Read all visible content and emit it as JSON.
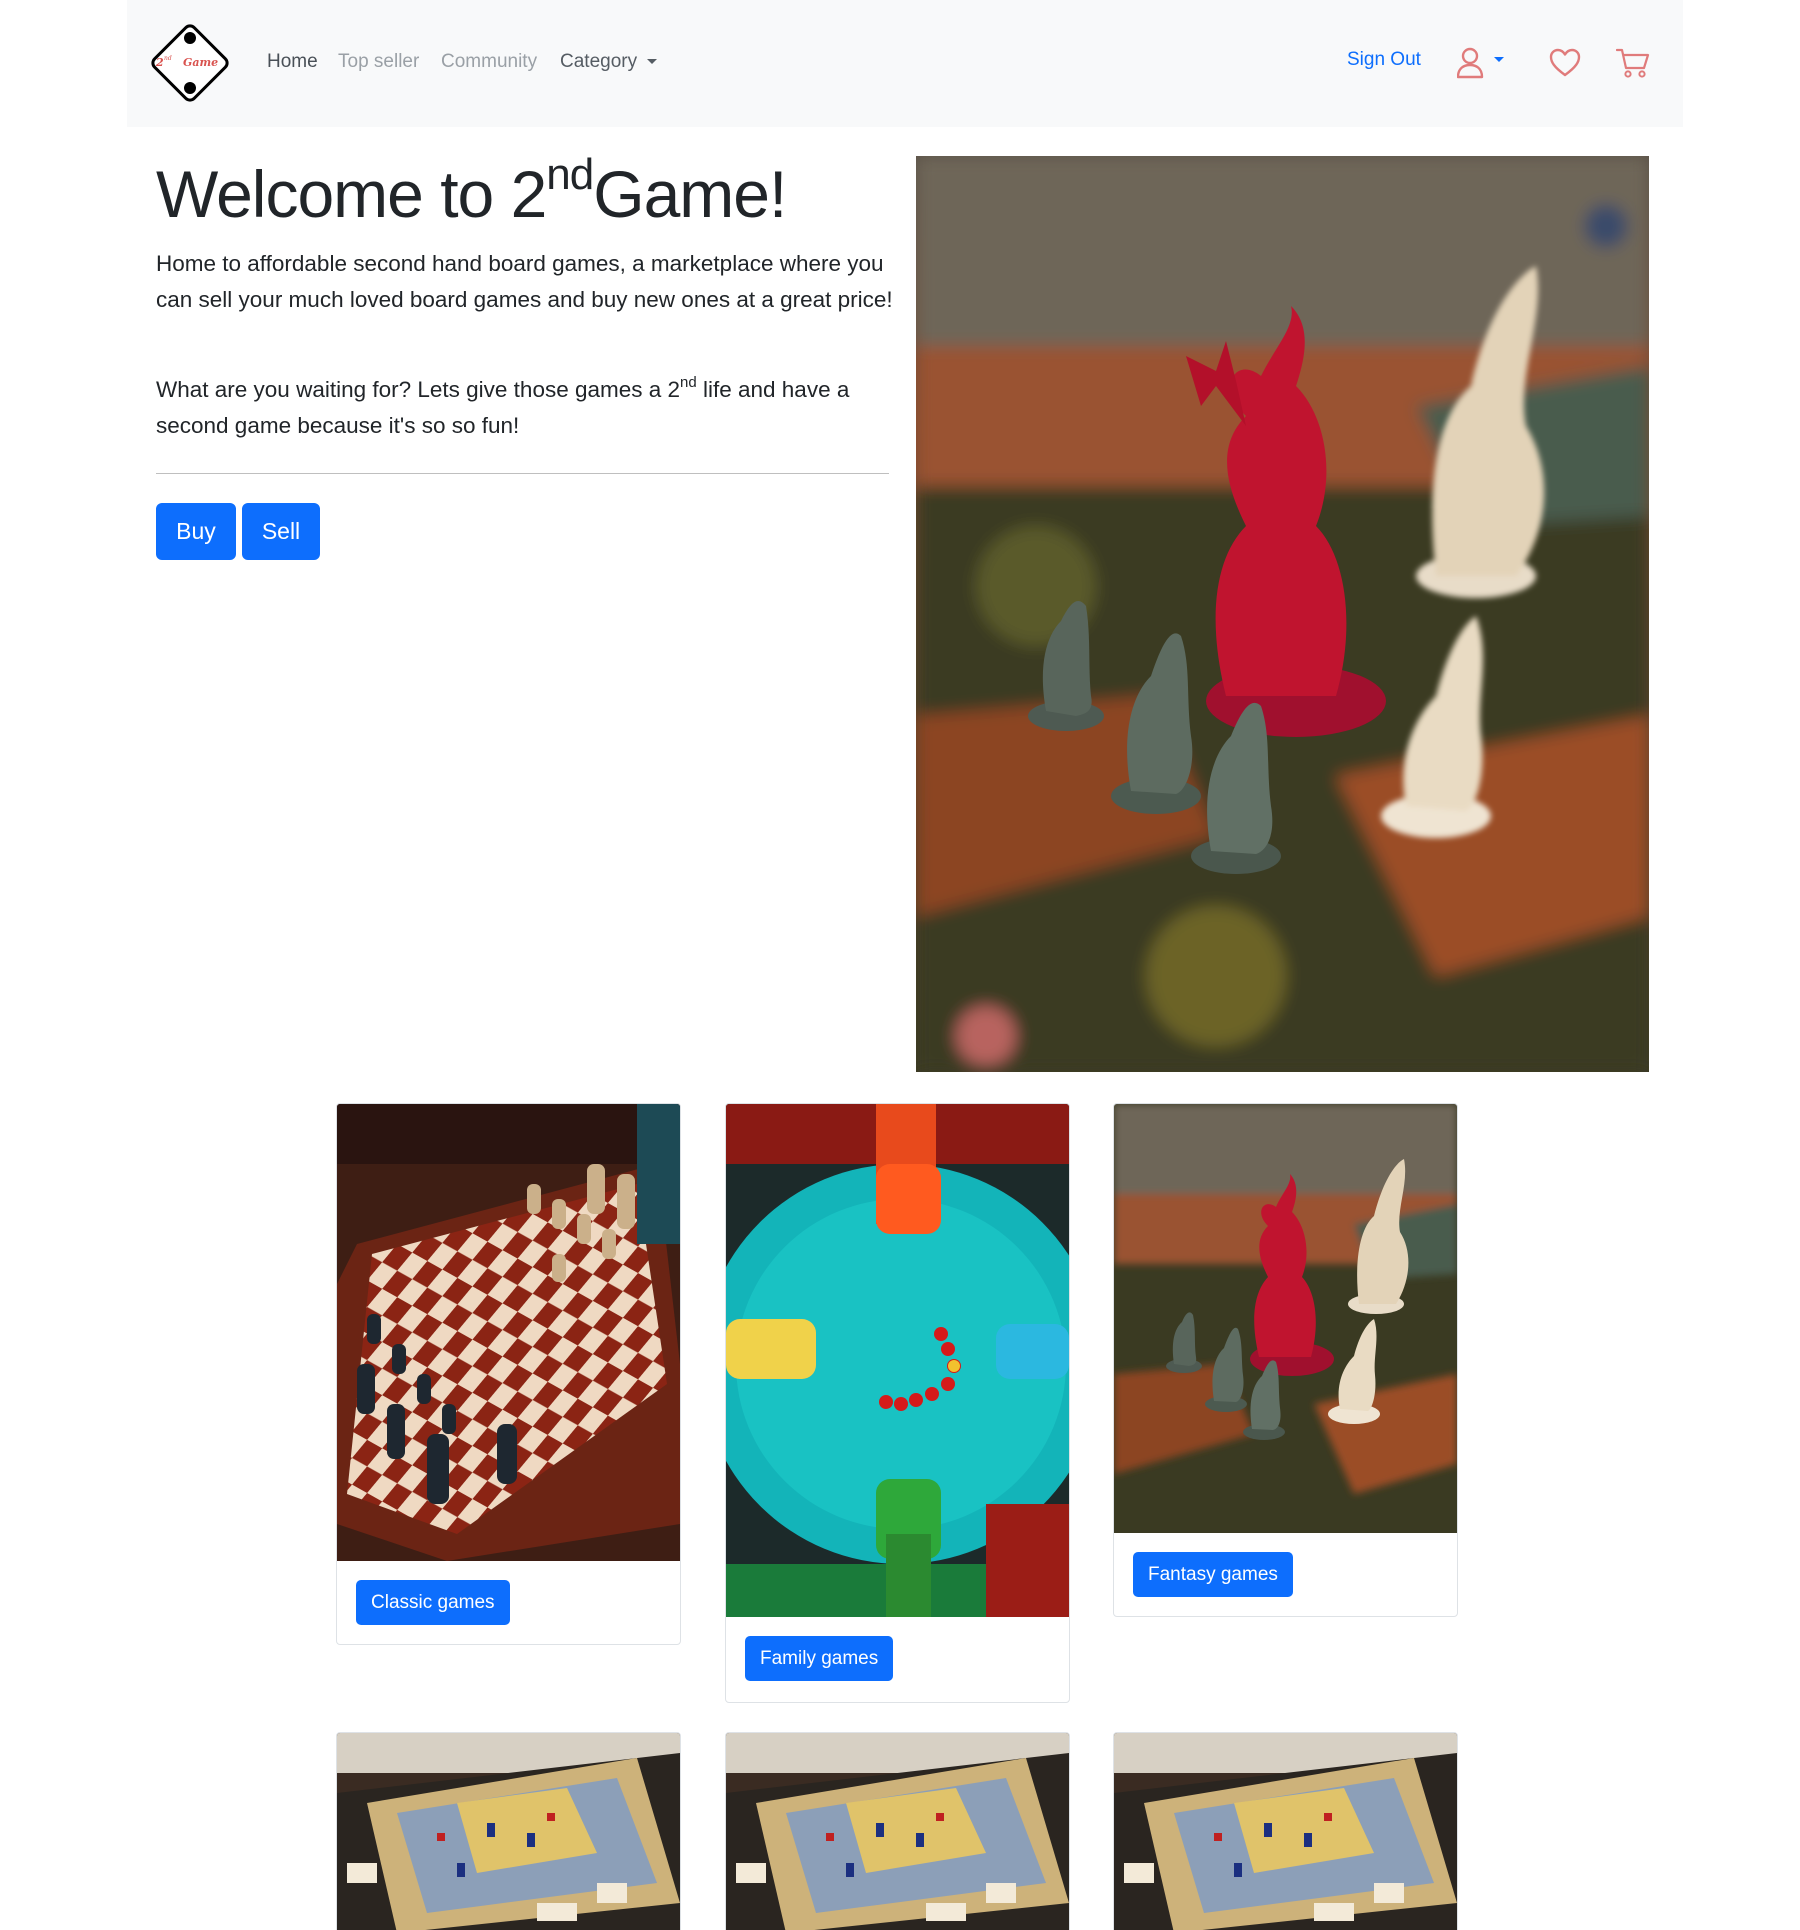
{
  "nav": {
    "logo_text": "2nd Game",
    "home": "Home",
    "top_seller": "Top seller",
    "community": "Community",
    "category": "Category",
    "sign_out": "Sign Out"
  },
  "hero": {
    "title_pre": "Welcome to 2",
    "title_sup": "nd",
    "title_post": "Game!",
    "p1": "Home to affordable second hand board games, a marketplace where you can sell your much loved board games and buy new ones at a great price!",
    "p2_pre": "What are you waiting for? Lets give those games a 2",
    "p2_sup": "nd",
    "p2_post": " life and have a second game because it's so so fun!",
    "buy": "Buy",
    "sell": "Sell"
  },
  "cards": [
    {
      "label": "Classic games",
      "image": "chess-board"
    },
    {
      "label": "Family games",
      "image": "hungry-hippos"
    },
    {
      "label": "Fantasy games",
      "image": "fantasy-miniatures"
    },
    {
      "label": "",
      "image": "strategy-board-game"
    },
    {
      "label": "",
      "image": "strategy-board-game"
    },
    {
      "label": "",
      "image": "strategy-board-game"
    }
  ],
  "colors": {
    "primary": "#0d6efd",
    "navbar_bg": "#f8f9fa",
    "icon_accent": "#e07b7b"
  }
}
